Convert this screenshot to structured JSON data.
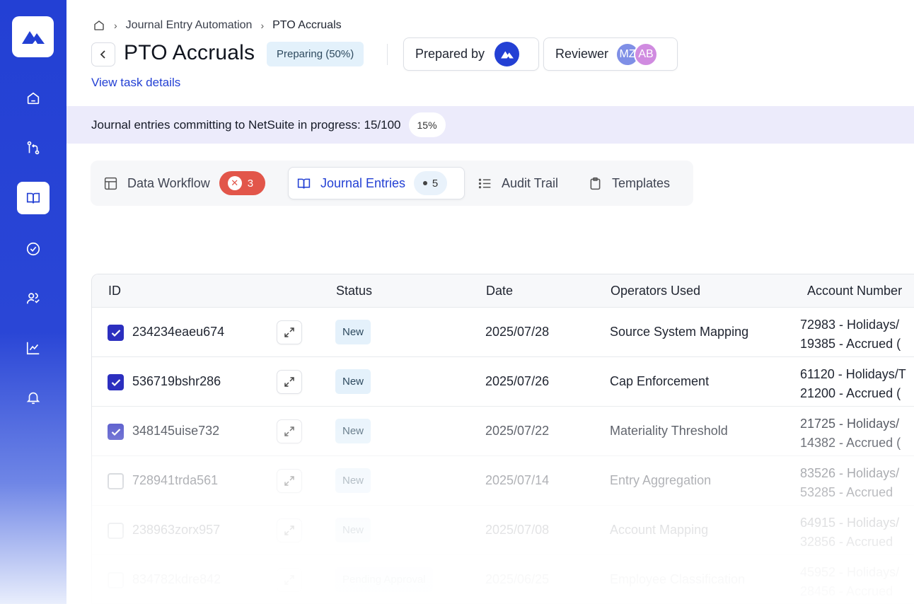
{
  "breadcrumb": {
    "parent": "Journal Entry Automation",
    "current": "PTO Accruals"
  },
  "header": {
    "title": "PTO Accruals",
    "status": "Preparing (50%)",
    "prepared_by_label": "Prepared by",
    "reviewer_label": "Reviewer",
    "reviewers": [
      "MZ",
      "AB"
    ],
    "task_link": "View task details"
  },
  "banner": {
    "text": "Journal entries committing to NetSuite in progress: 15/100",
    "percent": "15%"
  },
  "tabs": [
    {
      "label": "Data Workflow",
      "badge": "3"
    },
    {
      "label": "Journal Entries",
      "badge": "5"
    },
    {
      "label": "Audit Trail"
    },
    {
      "label": "Templates"
    }
  ],
  "table": {
    "columns": [
      "ID",
      "Status",
      "Date",
      "Operators Used",
      "Account Number"
    ],
    "rows": [
      {
        "id": "234234eaeu674",
        "status": "New",
        "date": "2025/07/28",
        "operator": "Source System Mapping",
        "acct1": "72983 - Holidays/",
        "acct2": "19385 - Accrued (",
        "checked": true
      },
      {
        "id": "536719bshr286",
        "status": "New",
        "date": "2025/07/26",
        "operator": "Cap Enforcement",
        "acct1": "61120 - Holidays/T",
        "acct2": "21200 - Accrued (",
        "checked": true
      },
      {
        "id": "348145uise732",
        "status": "New",
        "date": "2025/07/22",
        "operator": "Materiality Threshold",
        "acct1": "21725 - Holidays/",
        "acct2": "14382 - Accrued (",
        "checked": true
      },
      {
        "id": "728941trda561",
        "status": "New",
        "date": "2025/07/14",
        "operator": "Entry Aggregation",
        "acct1": "83526 - Holidays/",
        "acct2": "53285 - Accrued",
        "checked": false
      },
      {
        "id": "238963zorx957",
        "status": "New",
        "date": "2025/07/08",
        "operator": "Account Mapping",
        "acct1": "64915 - Holidays/",
        "acct2": "32856 - Accrued",
        "checked": false
      },
      {
        "id": "834782kdre842",
        "status": "Pending Approval",
        "date": "2025/06/25",
        "operator": "Employee Classification",
        "acct1": "45952 - Holidays/",
        "acct2": "28456 - Accrued",
        "checked": false
      }
    ]
  },
  "colors": {
    "brand": "#2340d4",
    "error": "#e2564a",
    "checkbox": "#2c2fbf",
    "banner": "#ecebfb"
  }
}
